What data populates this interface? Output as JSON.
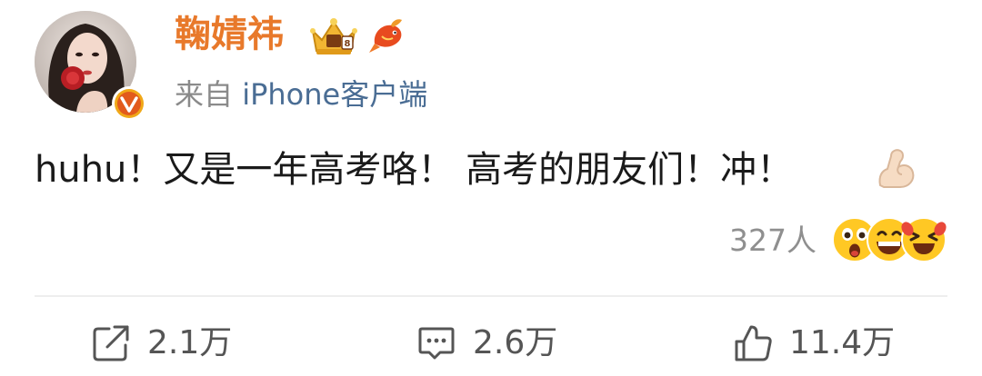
{
  "post": {
    "author": {
      "name": "鞠婧祎",
      "crown_icon": "crown-badge-icon",
      "fish_icon": "koi-fish-icon",
      "verified_icon": "verified-v-icon"
    },
    "source": {
      "prefix": "来自",
      "client": "iPhone客户端"
    },
    "text": "huhu！又是一年高考咯！ 高考的朋友们！冲！",
    "text_emoji": "flexed-biceps-icon",
    "reactions": {
      "count_label": "327人",
      "emojis": [
        "surprised-face-icon",
        "grinning-face-icon",
        "laughing-face-icon"
      ]
    },
    "actions": {
      "repost": {
        "icon": "share-icon",
        "count": "2.1万"
      },
      "comment": {
        "icon": "comment-icon",
        "count": "2.6万"
      },
      "like": {
        "icon": "thumbs-up-icon",
        "count": "11.4万"
      }
    }
  },
  "colors": {
    "username": "#e8792b",
    "link": "#4a6d94",
    "secondary_text": "#8a8a8a",
    "body_text": "#1a1a1a"
  }
}
